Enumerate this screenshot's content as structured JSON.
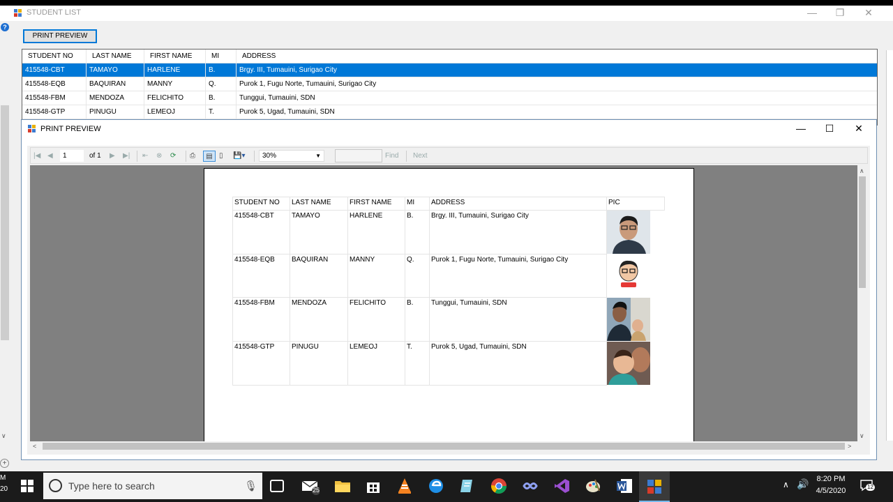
{
  "main_window": {
    "title": "STUDENT LIST",
    "print_preview_button": "PRINT PREVIEW",
    "controls": {
      "minimize": "—",
      "restore": "❐",
      "close": "✕"
    }
  },
  "grid": {
    "columns": [
      "STUDENT NO",
      "LAST NAME",
      "FIRST NAME",
      "MI",
      "ADDRESS"
    ],
    "rows": [
      [
        "415548-CBT",
        "TAMAYO",
        "HARLENE",
        "B.",
        "Brgy. III, Tumauini, Surigao City"
      ],
      [
        "415548-EQB",
        "BAQUIRAN",
        "MANNY",
        "Q.",
        "Purok 1, Fugu Norte, Tumauini, Surigao City"
      ],
      [
        "415548-FBM",
        "MENDOZA",
        "FELICHITO",
        "B.",
        "Tunggui, Tumauini, SDN"
      ],
      [
        "415548-GTP",
        "PINUGU",
        "LEMEOJ",
        "T.",
        "Purok 5, Ugad, Tumauini, SDN"
      ]
    ],
    "selected_row": 0
  },
  "print_preview": {
    "title": "PRINT PREVIEW",
    "controls": {
      "minimize": "—",
      "maximize": "☐",
      "close": "✕"
    },
    "toolbar": {
      "page_current": "1",
      "page_of": "of 1",
      "zoom": "30%",
      "find_label": "Find",
      "next_label": "Next"
    },
    "report": {
      "columns": [
        "STUDENT NO",
        "LAST NAME",
        "FIRST NAME",
        "MI",
        "ADDRESS",
        "PIC"
      ],
      "rows": [
        [
          "415548-CBT",
          "TAMAYO",
          "HARLENE",
          "B.",
          "Brgy. III, Tumauini, Surigao City"
        ],
        [
          "415548-EQB",
          "BAQUIRAN",
          "MANNY",
          "Q.",
          "Purok 1, Fugu Norte, Tumauini, Surigao City"
        ],
        [
          "415548-FBM",
          "MENDOZA",
          "FELICHITO",
          "B.",
          "Tunggui, Tumauini, SDN"
        ],
        [
          "415548-GTP",
          "PINUGU",
          "LEMEOJ",
          "T.",
          "Purok 5, Ugad, Tumauini, SDN"
        ]
      ]
    }
  },
  "taskbar": {
    "search_placeholder": "Type here to search",
    "mail_badge": "25",
    "time": "8:20 PM",
    "date": "4/5/2020",
    "notification_count": "12"
  },
  "left_edge": {
    "line1": "M",
    "line2": "20"
  },
  "colors": {
    "selection": "#0078d7",
    "taskbar": "#1b1b1b",
    "preview_bg": "#808080"
  }
}
